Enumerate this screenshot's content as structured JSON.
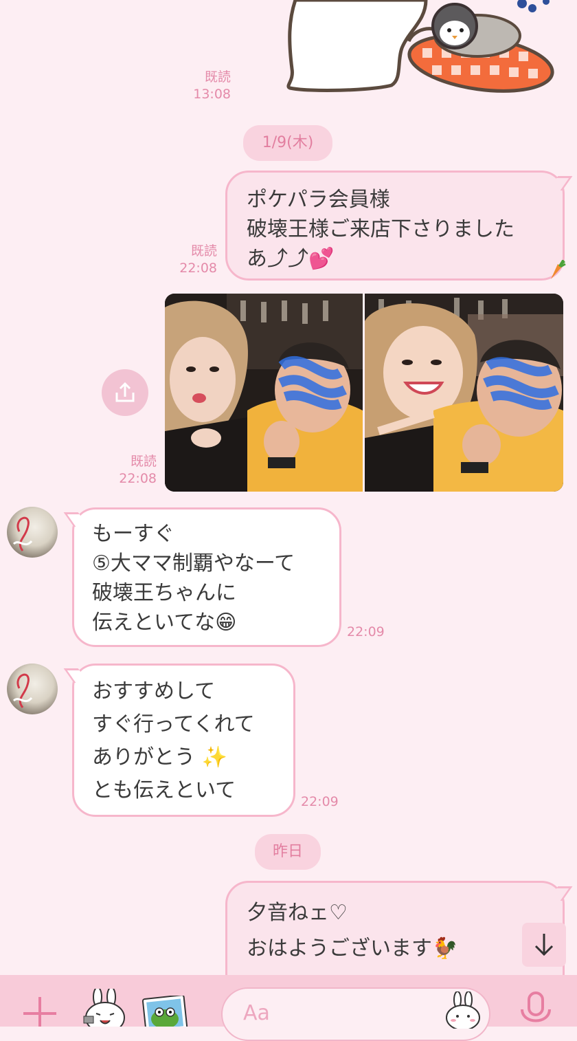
{
  "messages": {
    "m1": {
      "read": "既読",
      "time": "13:08"
    },
    "date1": "1/9(木)",
    "m2": {
      "lines": [
        "ポケパラ会員様",
        "破壊王様ご来店下さりました",
        "あ⤴⤴💕"
      ],
      "read": "既読",
      "time": "22:08"
    },
    "m3": {
      "read": "既読",
      "time": "22:08"
    },
    "m4": {
      "lines": [
        "もーすぐ",
        "⑤大ママ制覇やなーて",
        "破壊王ちゃんに",
        "伝えといてな😁"
      ],
      "time": "22:09"
    },
    "m5": {
      "lines": [
        "おすすめして",
        "すぐ行ってくれて",
        "ありがとう ✨",
        "とも伝えといて"
      ],
      "time": "22:09"
    },
    "date2": "昨日",
    "m6": {
      "lines": [
        "夕音ねェ♡",
        "おはようございます🐓"
      ]
    }
  },
  "input": {
    "placeholder": "Aa"
  },
  "colors": {
    "accent": "#f6b6cb",
    "background": "#fdeef3",
    "bar": "#f8cbd9"
  },
  "icons": [
    "plus-icon",
    "sticker-bunny-icon",
    "photo-frog-icon",
    "emoji-bunny-icon",
    "mic-icon",
    "share-icon",
    "arrow-down-icon",
    "carrot-icon"
  ]
}
